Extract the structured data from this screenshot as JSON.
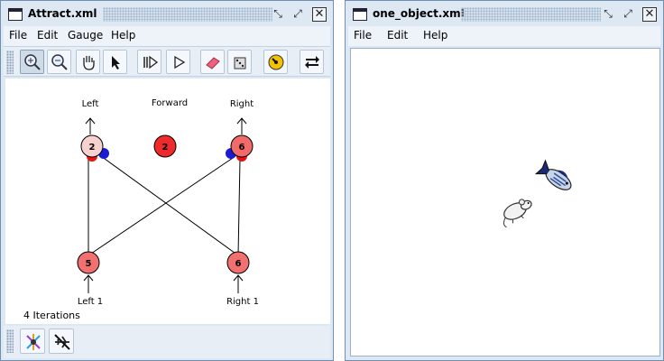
{
  "left_window": {
    "title": "Attract.xml",
    "menu": [
      "File",
      "Edit",
      "Gauge",
      "Help"
    ],
    "toolbar": [
      "zoom-in",
      "zoom-out",
      "pan-hand",
      "select-arrow",
      "iterate-step",
      "play",
      "eraser",
      "random-dice",
      "gauge",
      "swap-arrows"
    ],
    "network": {
      "nodes": [
        {
          "id": "left",
          "label": "Left",
          "activation": "2",
          "color": "#f7d0d0"
        },
        {
          "id": "forward",
          "label": "Forward",
          "activation": "2",
          "color": "#ee2a2a"
        },
        {
          "id": "right",
          "label": "Right",
          "activation": "6",
          "color": "#f26a6a"
        },
        {
          "id": "left1",
          "label": "Left 1",
          "activation": "5",
          "color": "#f27070"
        },
        {
          "id": "right1",
          "label": "Right 1",
          "activation": "6",
          "color": "#f27070"
        }
      ],
      "iterations": "4 Iterations"
    },
    "bottom_tools": [
      "network-tool",
      "no-plane-tool"
    ]
  },
  "right_window": {
    "title": "one_object.xml",
    "menu": [
      "File",
      "Edit",
      "Help"
    ],
    "world_objects": [
      "fish",
      "mouse"
    ]
  }
}
